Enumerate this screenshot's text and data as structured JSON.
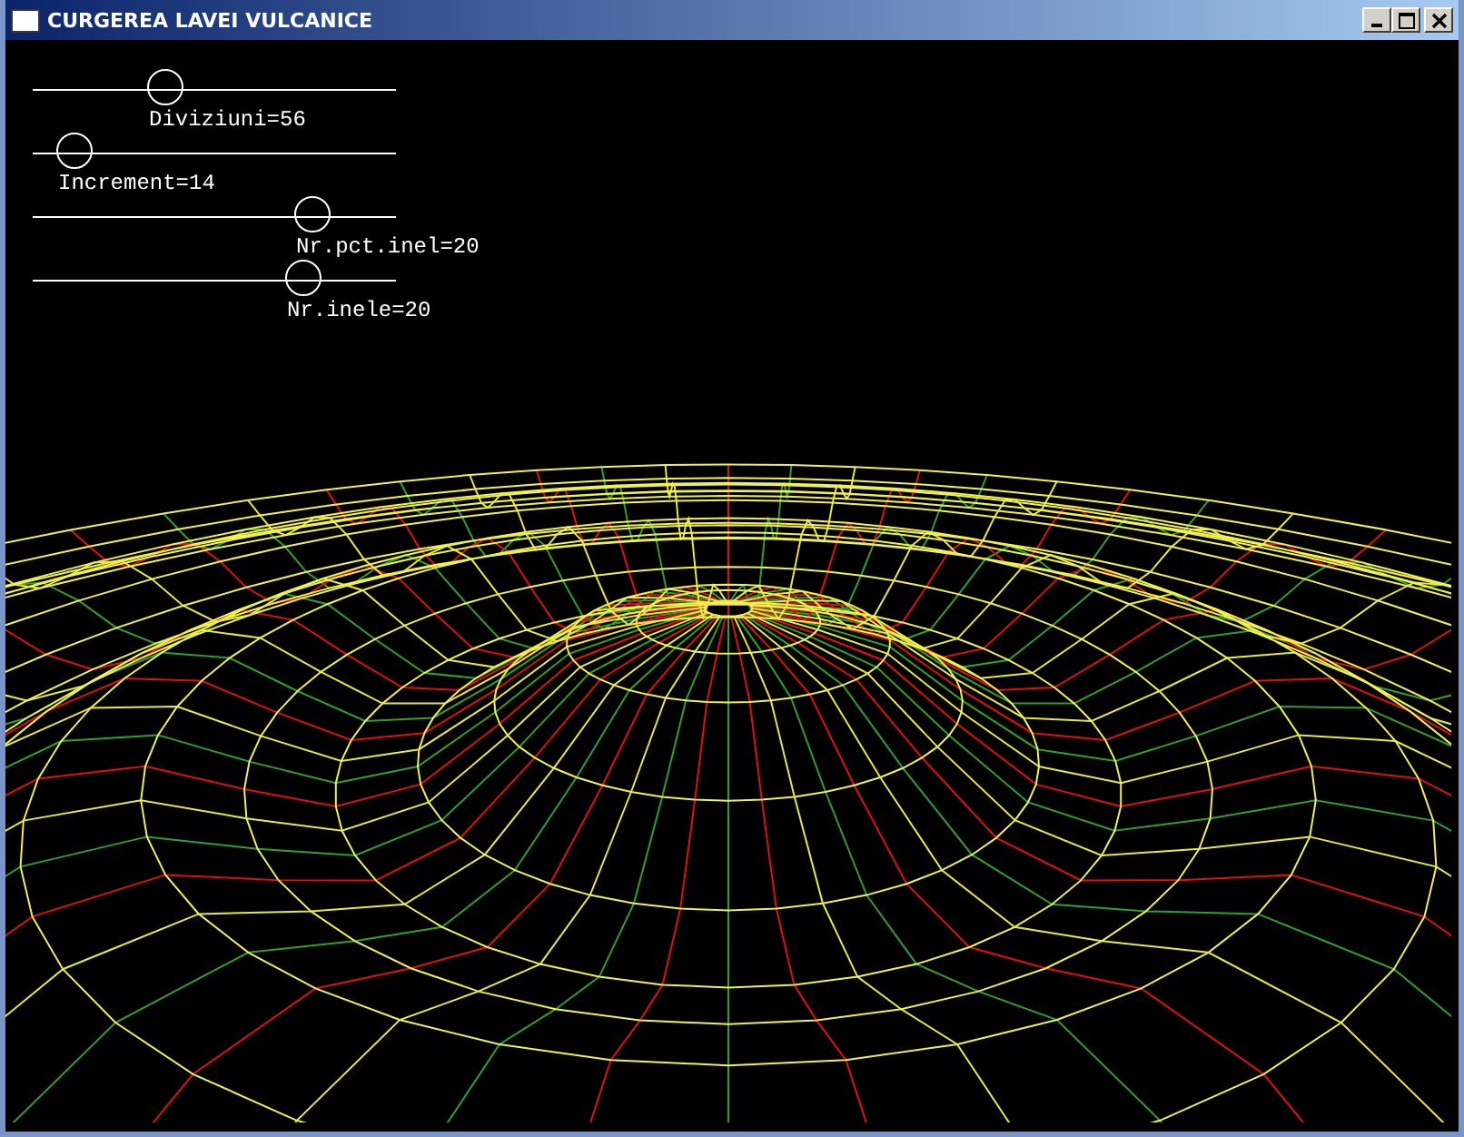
{
  "window": {
    "title": "CURGEREA LAVEI VULCANICE"
  },
  "sliders": [
    {
      "label": "Diviziuni=56",
      "level": 0.37
    },
    {
      "label": "Increment=14",
      "level": 0.12
    },
    {
      "label": "Nr.pct.inel=20",
      "level": 0.775
    },
    {
      "label": "Nr.inele=20",
      "level": 0.75
    }
  ]
}
